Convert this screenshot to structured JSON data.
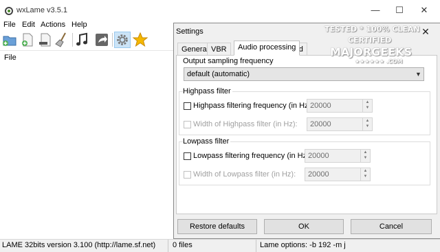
{
  "window": {
    "title": "wxLame v3.5.1"
  },
  "menu": [
    "File",
    "Edit",
    "Actions",
    "Help"
  ],
  "toolbar": {
    "buttons": [
      "add-files-icon",
      "add-folder-icon",
      "remove-file-icon",
      "clear-list-icon",
      "play-icon",
      "encode-icon",
      "settings-icon",
      "favorite-icon"
    ]
  },
  "list": {
    "column_header": "File"
  },
  "status": {
    "version": "LAME 32bits version 3.100 (http://lame.sf.net)",
    "files": "0 files",
    "options": "Lame options: -b 192 -m j"
  },
  "dialog": {
    "title": "Settings",
    "close": "✕",
    "tabs": [
      "General",
      "VBR",
      "Audio processing",
      "Advanced"
    ],
    "active_tab": "Audio processing",
    "output_sampling": {
      "label": "Output sampling frequency",
      "selected": "default (automatic)"
    },
    "highpass": {
      "group": "Highpass filter",
      "freq_label": "Highpass filtering frequency (in Hz):",
      "freq_value": "20000",
      "width_label": "Width of Highpass filter (in Hz):",
      "width_value": "20000"
    },
    "lowpass": {
      "group": "Lowpass filter",
      "freq_label": "Lowpass filtering frequency (in Hz):",
      "freq_value": "20000",
      "width_label": "Width of Lowpass filter (in Hz):",
      "width_value": "20000"
    },
    "buttons": {
      "restore": "Restore defaults",
      "ok": "OK",
      "cancel": "Cancel"
    }
  },
  "watermark": {
    "line1": "TESTED * 100% CLEAN",
    "line2": "CERTIFIED",
    "line3": "MAJORGEEKS",
    "line4": "★★★★★★ .COM"
  }
}
